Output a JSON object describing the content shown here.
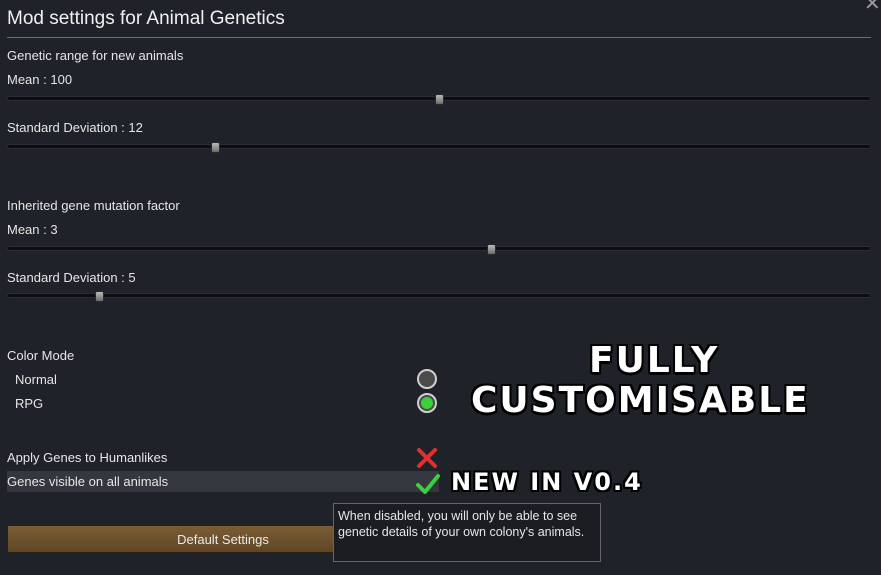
{
  "window": {
    "title": "Mod settings for Animal Genetics"
  },
  "genetic_range": {
    "heading": "Genetic range for new animals",
    "mean_label": "Mean : 100",
    "mean_value_fraction": 0.5,
    "sd_label": "Standard Deviation : 12",
    "sd_value_fraction": 0.24
  },
  "mutation": {
    "heading": "Inherited gene mutation factor",
    "mean_label": "Mean : 3",
    "mean_value_fraction": 0.56,
    "sd_label": "Standard Deviation : 5",
    "sd_value_fraction": 0.105
  },
  "color_mode": {
    "heading": "Color Mode",
    "options": [
      {
        "label": "Normal",
        "selected": false
      },
      {
        "label": "RPG",
        "selected": true
      }
    ]
  },
  "toggles": [
    {
      "label": "Apply Genes to Humanlikes",
      "enabled": false,
      "icon": "cross-icon"
    },
    {
      "label": "Genes visible on all animals",
      "enabled": true,
      "icon": "check-icon"
    }
  ],
  "button": {
    "label": "Default Settings"
  },
  "tooltip": {
    "text": "When disabled, you will only be able to see genetic details of your own colony's animals."
  },
  "promo": {
    "line1": "FULLY",
    "line2": "CUSTOMISABLE",
    "new_label": "NEW IN V0.4"
  },
  "colors": {
    "accent_green": "#3ad13a",
    "cross_red": "#e03030",
    "button_brown": "#6e5230"
  }
}
